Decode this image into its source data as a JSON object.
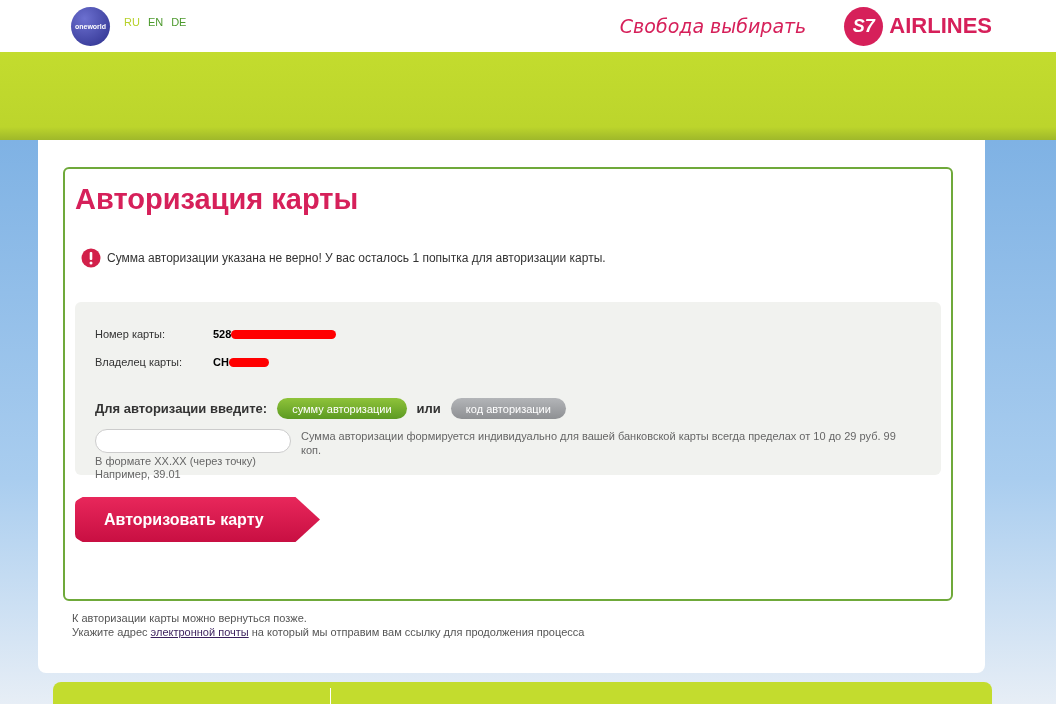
{
  "header": {
    "logo_text": "oneworld",
    "languages": [
      {
        "label": "RU",
        "selected": true
      },
      {
        "label": "EN",
        "selected": false
      },
      {
        "label": "DE",
        "selected": false
      }
    ],
    "slogan": "Свобода выбирать",
    "brand_mark": "S7",
    "brand_name": "AIRLINES"
  },
  "form": {
    "title": "Авторизация карты",
    "error": "Сумма авторизации указана не верно! У вас осталось 1 попытка для авторизации карты.",
    "fields": [
      {
        "label": "Номер карты:",
        "value": "528"
      },
      {
        "label": "Владелец карты:",
        "value": "CH"
      }
    ],
    "method_label": "Для авторизации введите:",
    "methods": [
      {
        "label": "сумму авторизации",
        "selected": true
      },
      {
        "label": "код авторизации",
        "selected": false
      }
    ],
    "or": "или",
    "hint": "Сумма авторизации формируется индивидуально для вашей банковской карты всегда пределах от 10 до 29 руб. 99 коп.",
    "format_note": "В формате XX.XX (через точку)",
    "example": "Например, 39.01",
    "submit": "Авторизовать карту"
  },
  "footer_note": {
    "line1": "К авторизации карты можно вернуться позже.",
    "before_link": "Укажите адрес",
    "link": "электронной почты",
    "after_link": "на который мы отправим вам ссылку для продолжения процесса"
  }
}
